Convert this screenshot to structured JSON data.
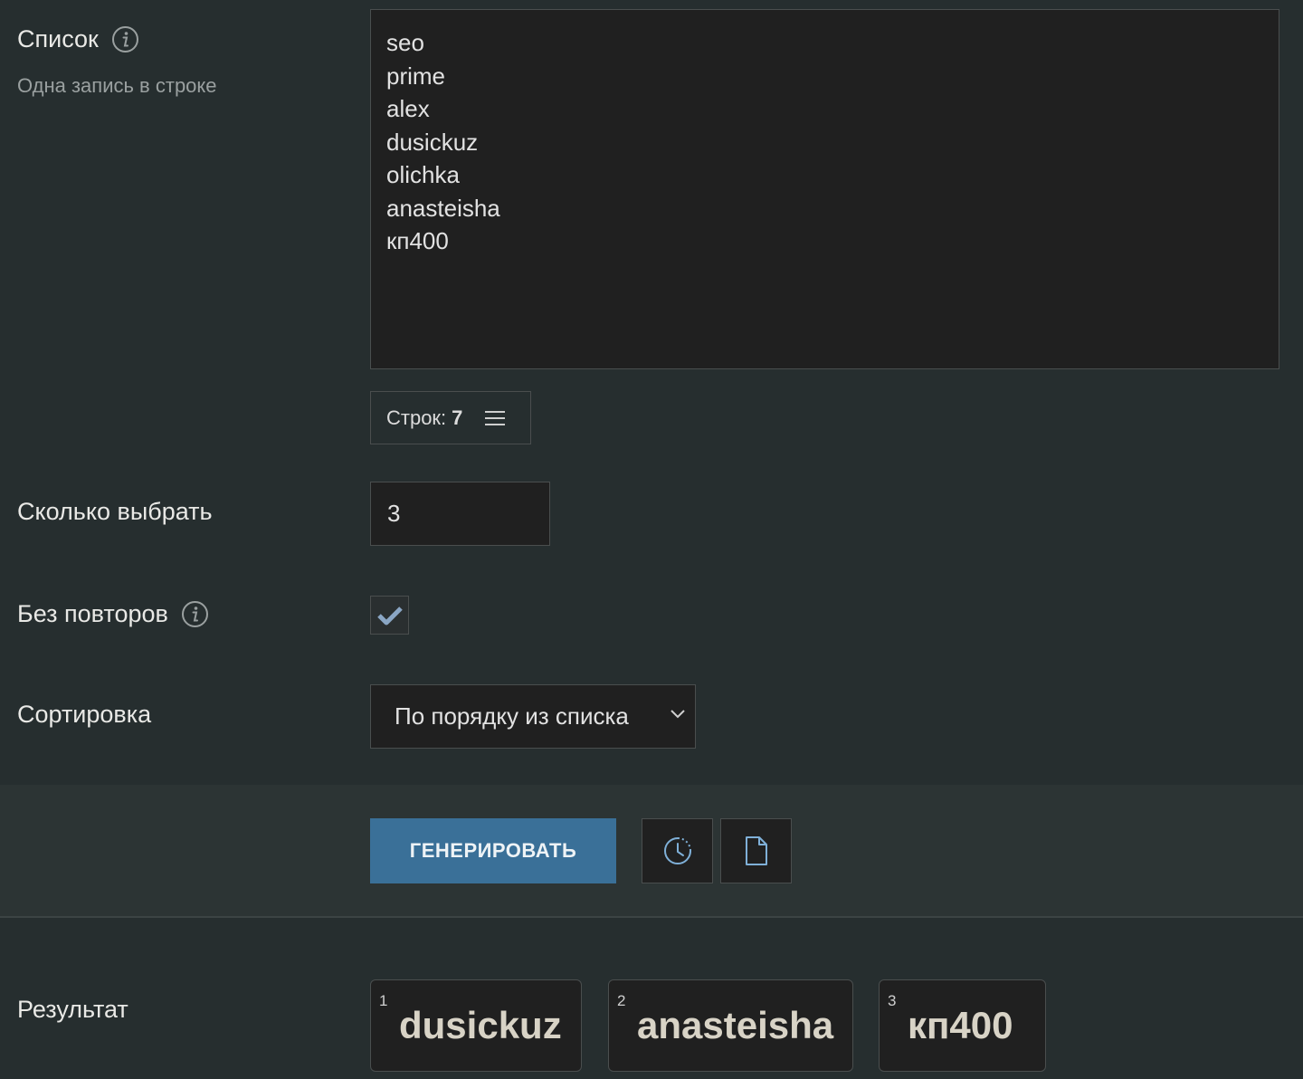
{
  "list_field": {
    "label": "Список",
    "hint": "Одна запись в строке",
    "lines": [
      "seo",
      "prime",
      "alex",
      "dusickuz",
      "olichka",
      "anasteisha",
      "кп400"
    ],
    "line_count_label": "Строк:",
    "line_count": "7"
  },
  "count_field": {
    "label": "Сколько выбрать",
    "value": "3"
  },
  "unique_field": {
    "label": "Без повторов",
    "checked": true
  },
  "sort_field": {
    "label": "Сортировка",
    "selected": "По порядку из списка"
  },
  "actions": {
    "generate_label": "ГЕНЕРИРОВАТЬ",
    "history_icon": "history-clock-icon",
    "file_icon": "document-icon"
  },
  "result": {
    "label": "Результат",
    "items": [
      {
        "index": "1",
        "value": "dusickuz"
      },
      {
        "index": "2",
        "value": "anasteisha"
      },
      {
        "index": "3",
        "value": "кп400"
      }
    ]
  },
  "colors": {
    "background": "#262e2f",
    "input_bg": "#202020",
    "accent": "#3a7098",
    "icon_blue": "#7fb0d8"
  }
}
